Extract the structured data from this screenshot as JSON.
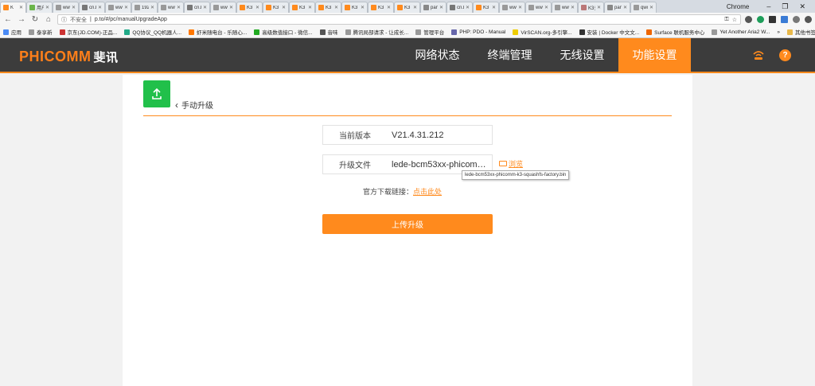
{
  "browser": {
    "tabs": [
      {
        "label": "K",
        "color": "#ff8a1d",
        "active": true
      },
      {
        "label": "用户",
        "color": "#6bb54a"
      },
      {
        "label": "www",
        "color": "#999"
      },
      {
        "label": "cn.b",
        "color": "#777"
      },
      {
        "label": "www",
        "color": "#999"
      },
      {
        "label": "192",
        "color": "#999"
      },
      {
        "label": "www",
        "color": "#999"
      },
      {
        "label": "cn.b",
        "color": "#777"
      },
      {
        "label": "www",
        "color": "#999"
      },
      {
        "label": "K3",
        "color": "#ff8a1d"
      },
      {
        "label": "K3",
        "color": "#ff8a1d"
      },
      {
        "label": "K3",
        "color": "#ff8a1d"
      },
      {
        "label": "K3",
        "color": "#ff8a1d"
      },
      {
        "label": "K3",
        "color": "#ff8a1d"
      },
      {
        "label": "K3",
        "color": "#ff8a1d"
      },
      {
        "label": "K3",
        "color": "#ff8a1d"
      },
      {
        "label": "pan",
        "color": "#888"
      },
      {
        "label": "cn.b",
        "color": "#777"
      },
      {
        "label": "K3",
        "color": "#ff8a1d"
      },
      {
        "label": "www",
        "color": "#999"
      },
      {
        "label": "www",
        "color": "#999"
      },
      {
        "label": "www",
        "color": "#999"
      },
      {
        "label": "K3多",
        "color": "#b77"
      },
      {
        "label": "pan",
        "color": "#888"
      },
      {
        "label": "qwo",
        "color": "#999"
      }
    ],
    "profile_label": "Chrome",
    "win_min": "–",
    "win_max": "❐",
    "win_close": "✕",
    "security_text": "不安全",
    "url": "p.to/#/pc/manualUpgradeApp",
    "bookmarks": [
      {
        "label": "应用",
        "color": "#4b8bf5"
      },
      {
        "label": "泰享新",
        "color": "#999"
      },
      {
        "label": "京东(JD.COM)-正品...",
        "color": "#c33"
      },
      {
        "label": "QQ协议_QQ机器人...",
        "color": "#2a8"
      },
      {
        "label": "虾米随电台 - 乐随心...",
        "color": "#f70"
      },
      {
        "label": "高级数值接口 - 微信...",
        "color": "#2a2"
      },
      {
        "label": "音味",
        "color": "#555"
      },
      {
        "label": "腾讯局部请求 - 让成长...",
        "color": "#999"
      },
      {
        "label": "管理平台",
        "color": "#999"
      },
      {
        "label": "PHP: PDO - Manual",
        "color": "#66a"
      },
      {
        "label": "VirSCAN.org-多引擎...",
        "color": "#ec0"
      },
      {
        "label": "安装 | Docker 中文文...",
        "color": "#333"
      },
      {
        "label": "Surface 联机服务中心",
        "color": "#e60"
      },
      {
        "label": "Yet Another Aria2 W...",
        "color": "#999"
      }
    ],
    "bookmarks_more": "»",
    "other_bookmarks": "其他书签"
  },
  "header": {
    "logo_en": "PHICOMM",
    "logo_cn": "斐讯",
    "nav": [
      {
        "label": "网络状态",
        "active": false
      },
      {
        "label": "终端管理",
        "active": false
      },
      {
        "label": "无线设置",
        "active": false
      },
      {
        "label": "功能设置",
        "active": true
      }
    ],
    "help_glyph": "?"
  },
  "page": {
    "back_label": "手动升级",
    "current_version_label": "当前版本",
    "current_version_value": "V21.4.31.212",
    "upgrade_file_label": "升级文件",
    "upgrade_file_value": "lede-bcm53xx-phicomm-k3-squashfs-factory.bin",
    "browse_label": "浏览",
    "tooltip": "lede-bcm53xx-phicomm-k3-squashfs-factory.bin",
    "download_text": "官方下载链接：",
    "download_link": "点击此处",
    "submit_label": "上传升级"
  },
  "colors": {
    "accent": "#ff8a1d",
    "header_bg": "#3c3c3c",
    "badge": "#21c04a"
  }
}
